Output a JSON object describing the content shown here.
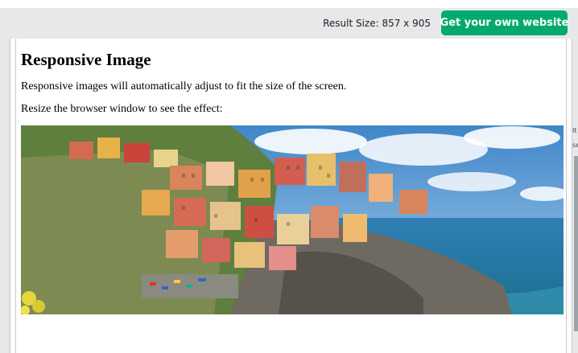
{
  "toolbar": {
    "result_size": "Result Size: 857 x 905",
    "cta_label": "Get your own website",
    "cta_color": "#04aa6d"
  },
  "page": {
    "title": "Responsive Image",
    "paragraphs": [
      "Responsive images will automatically adjust to fit the size of the screen.",
      "Resize the browser window to see the effect:"
    ]
  },
  "right_edge_fragments": [
    "It",
    "se"
  ]
}
